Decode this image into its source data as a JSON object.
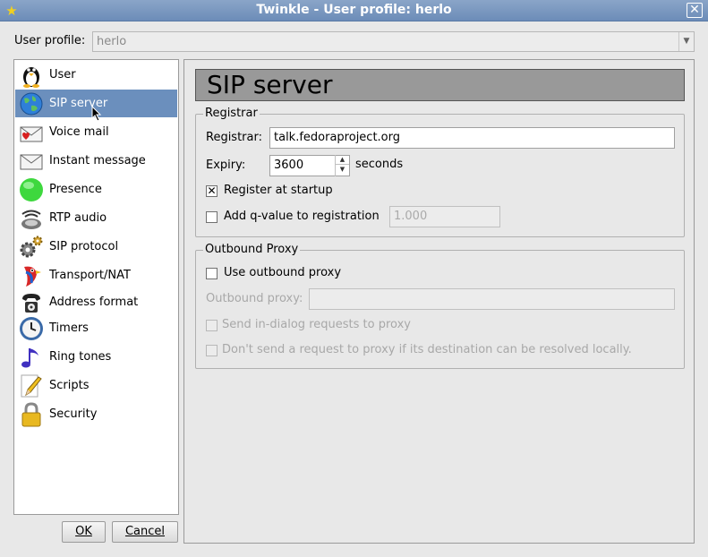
{
  "window": {
    "title": "Twinkle - User profile: herlo",
    "close_glyph": "✕",
    "app_icon": "star-icon"
  },
  "profile": {
    "label": "User profile:",
    "value": "herlo"
  },
  "categories": [
    {
      "label": "User",
      "icon": "penguin-icon"
    },
    {
      "label": "SIP server",
      "icon": "globe-icon",
      "selected": true
    },
    {
      "label": "Voice mail",
      "icon": "envelope-heart-icon"
    },
    {
      "label": "Instant message",
      "icon": "envelope-icon"
    },
    {
      "label": "Presence",
      "icon": "green-ball-icon"
    },
    {
      "label": "RTP audio",
      "icon": "speaker-icon"
    },
    {
      "label": "SIP protocol",
      "icon": "gears-icon"
    },
    {
      "label": "Transport/NAT",
      "icon": "parrot-icon"
    },
    {
      "label": "Address format",
      "icon": "telephone-icon"
    },
    {
      "label": "Timers",
      "icon": "clock-icon"
    },
    {
      "label": "Ring tones",
      "icon": "music-note-icon"
    },
    {
      "label": "Scripts",
      "icon": "pencil-icon"
    },
    {
      "label": "Security",
      "icon": "padlock-icon"
    }
  ],
  "buttons": {
    "ok": "OK",
    "cancel": "Cancel"
  },
  "page": {
    "title": "SIP server",
    "registrar_group": {
      "title": "Registrar",
      "registrar_label": "Registrar:",
      "registrar_value": "talk.fedoraproject.org",
      "expiry_label": "Expiry:",
      "expiry_value": "3600",
      "expiry_unit": "seconds",
      "register_at_startup": {
        "label": "Register at startup",
        "checked": true
      },
      "add_qvalue": {
        "label": "Add q-value to registration",
        "checked": false,
        "value": "1.000"
      }
    },
    "proxy_group": {
      "title": "Outbound Proxy",
      "use_proxy": {
        "label": "Use outbound proxy",
        "checked": false
      },
      "proxy_label": "Outbound proxy:",
      "proxy_value": "",
      "in_dialog": {
        "label": "Send in-dialog requests to proxy",
        "checked": false
      },
      "dont_send": {
        "label": "Don't send a request to proxy if its destination can be resolved locally.",
        "checked": false
      }
    }
  },
  "colors": {
    "selection": "#6b8fbd",
    "titlebar": "#7a98c0",
    "page_title_bg": "#999999"
  }
}
